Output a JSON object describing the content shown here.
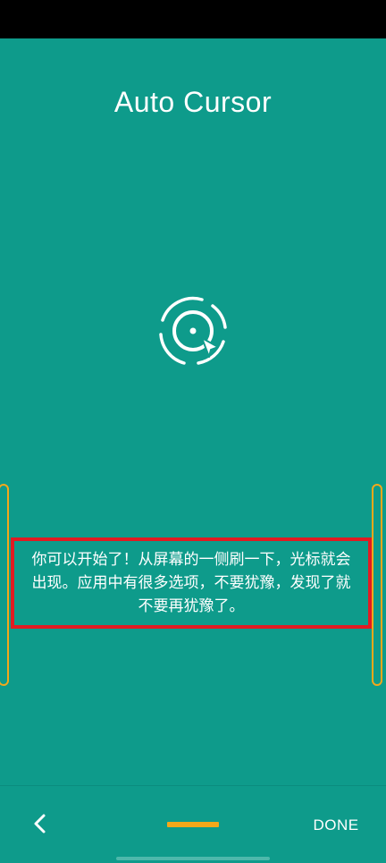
{
  "app": {
    "title": "Auto Cursor"
  },
  "onboarding": {
    "message": "你可以开始了！从屏幕的一侧刷一下，光标就会出现。应用中有很多选项，不要犹豫，发现了就不要再犹豫了。"
  },
  "navigation": {
    "back_icon": "chevron-left-icon",
    "done_label": "DONE",
    "current_page": 1
  },
  "colors": {
    "background": "#0e9b8b",
    "accent": "#f4a81a",
    "highlight": "#e11b22",
    "text": "#ffffff"
  }
}
